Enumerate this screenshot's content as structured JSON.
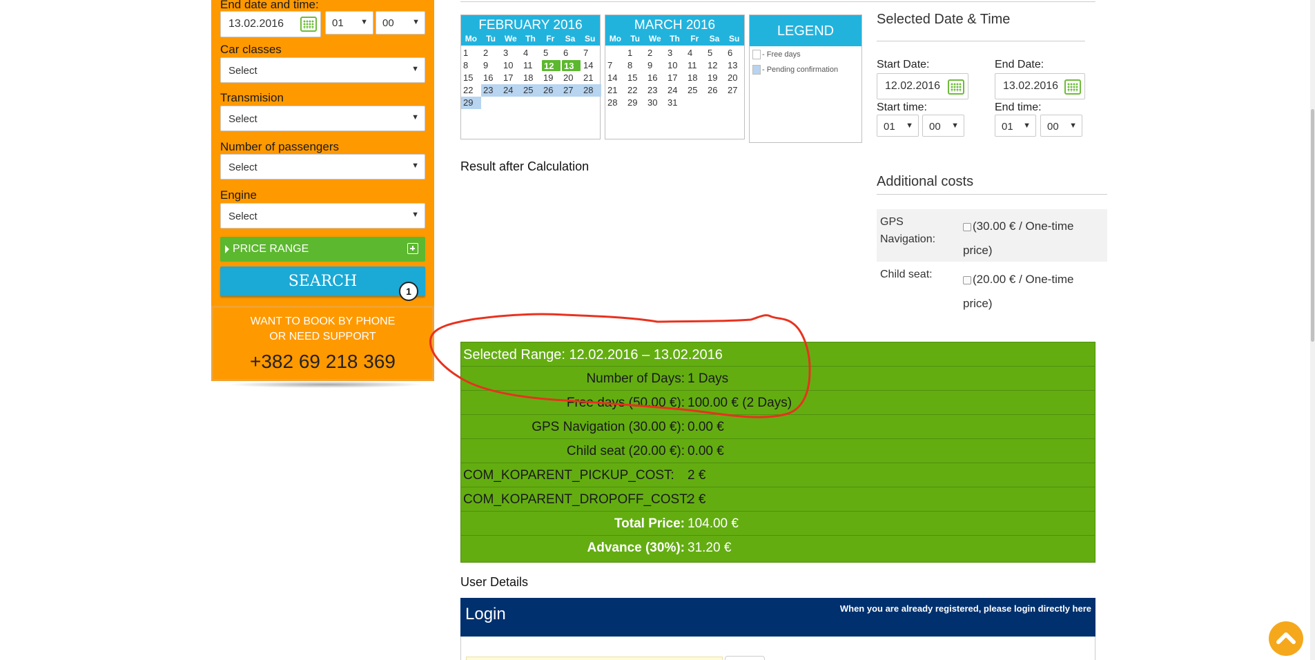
{
  "sidebar": {
    "end_label": "End date and time:",
    "end_date": "13.02.2016",
    "end_hour": "01",
    "end_min": "00",
    "car_classes_label": "Car classes",
    "car_classes_value": "Select",
    "transmission_label": "Transmision",
    "transmission_value": "Select",
    "passengers_label": "Number of passengers",
    "passengers_value": "Select",
    "engine_label": "Engine",
    "engine_value": "Select",
    "price_range_label": "PRICE RANGE",
    "search_label": "SEARCH",
    "search_badge": "1",
    "phone_line1": "WANT TO BOOK BY PHONE",
    "phone_line2": "OR NEED SUPPORT",
    "phone_number": "+382 69 218 369"
  },
  "calendars": {
    "weekdays": [
      "Mo",
      "Tu",
      "We",
      "Th",
      "Fr",
      "Sa",
      "Su"
    ],
    "feb": {
      "title": "FEBRUARY 2016",
      "start_offset": 0,
      "days": 29,
      "selected": [
        12,
        13
      ],
      "pending": [
        23,
        24,
        25,
        26,
        27,
        28,
        29
      ]
    },
    "mar": {
      "title": "MARCH 2016",
      "start_offset": 1,
      "days": 31,
      "selected": [],
      "pending": []
    }
  },
  "legend": {
    "title": "LEGEND",
    "free_days": "- Free days",
    "pending": "- Pending confirmation",
    "pending_color": "#b7d4f0"
  },
  "selected_dt": {
    "title": "Selected Date & Time",
    "start_date_label": "Start Date:",
    "start_date": "12.02.2016",
    "end_date_label": "End Date:",
    "end_date": "13.02.2016",
    "start_time_label": "Start time:",
    "start_hour": "01",
    "start_min": "00",
    "end_time_label": "End time:",
    "end_hour": "01",
    "end_min": "00"
  },
  "result_title": "Result after Calculation",
  "additional": {
    "title": "Additional costs",
    "gps_label_1": "GPS",
    "gps_label_2": "Navigation:",
    "gps_price_1": "(30.00 € / One-time",
    "gps_price_2": "price)",
    "child_label": "Child seat:",
    "child_price_1": "(20.00 € / One-time",
    "child_price_2": "price)"
  },
  "summary": {
    "range": "Selected Range: 12.02.2016  –  13.02.2016",
    "rows": [
      {
        "k": "Number of Days:",
        "v": "1 Days"
      },
      {
        "k": "Free days (50.00 €):",
        "v": "100.00 € (2 Days)"
      },
      {
        "k": "GPS Navigation (30.00 €):",
        "v": "0.00 €"
      },
      {
        "k": "Child seat (20.00 €):",
        "v": "0.00 €"
      },
      {
        "k": "COM_KOPARENT_PICKUP_COST:",
        "v": "2 €"
      },
      {
        "k": "COM_KOPARENT_DROPOFF_COST:",
        "v": "2 €"
      },
      {
        "k": "Total Price:",
        "v": "104.00 €"
      },
      {
        "k": "Advance (30%):",
        "v": "31.20 €"
      }
    ],
    "green": "#63ad11"
  },
  "user_details": {
    "title": "User Details",
    "login_title": "Login",
    "login_hint": "When you are already registered, please login directly here"
  },
  "colors": {
    "orange": "#ff9900",
    "blue": "#22b3dd",
    "navy": "#00306e",
    "annotation": "#e8321e"
  }
}
